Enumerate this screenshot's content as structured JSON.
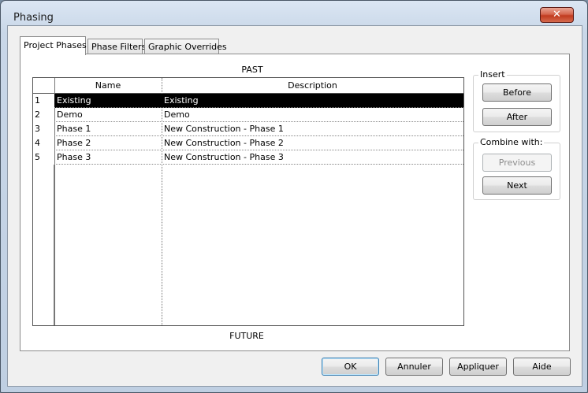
{
  "window": {
    "title": "Phasing",
    "close_glyph": "✕"
  },
  "tabs": [
    {
      "label": "Project Phases",
      "active": true
    },
    {
      "label": "Phase Filters",
      "active": false
    },
    {
      "label": "Graphic Overrides",
      "active": false
    }
  ],
  "phases": {
    "past_label": "PAST",
    "future_label": "FUTURE",
    "columns": {
      "name": "Name",
      "description": "Description"
    },
    "rows": [
      {
        "num": "1",
        "name": "Existing",
        "description": "Existing",
        "selected": true
      },
      {
        "num": "2",
        "name": "Demo",
        "description": "Demo",
        "selected": false
      },
      {
        "num": "3",
        "name": "Phase 1",
        "description": "New Construction - Phase 1",
        "selected": false
      },
      {
        "num": "4",
        "name": "Phase 2",
        "description": "New Construction - Phase 2",
        "selected": false
      },
      {
        "num": "5",
        "name": "Phase 3",
        "description": "New Construction - Phase 3",
        "selected": false
      }
    ]
  },
  "insert": {
    "label": "Insert",
    "before": "Before",
    "after": "After"
  },
  "combine": {
    "label": "Combine with:",
    "previous": "Previous",
    "next": "Next"
  },
  "footer": {
    "ok": "OK",
    "cancel": "Annuler",
    "apply": "Appliquer",
    "help": "Aide"
  }
}
